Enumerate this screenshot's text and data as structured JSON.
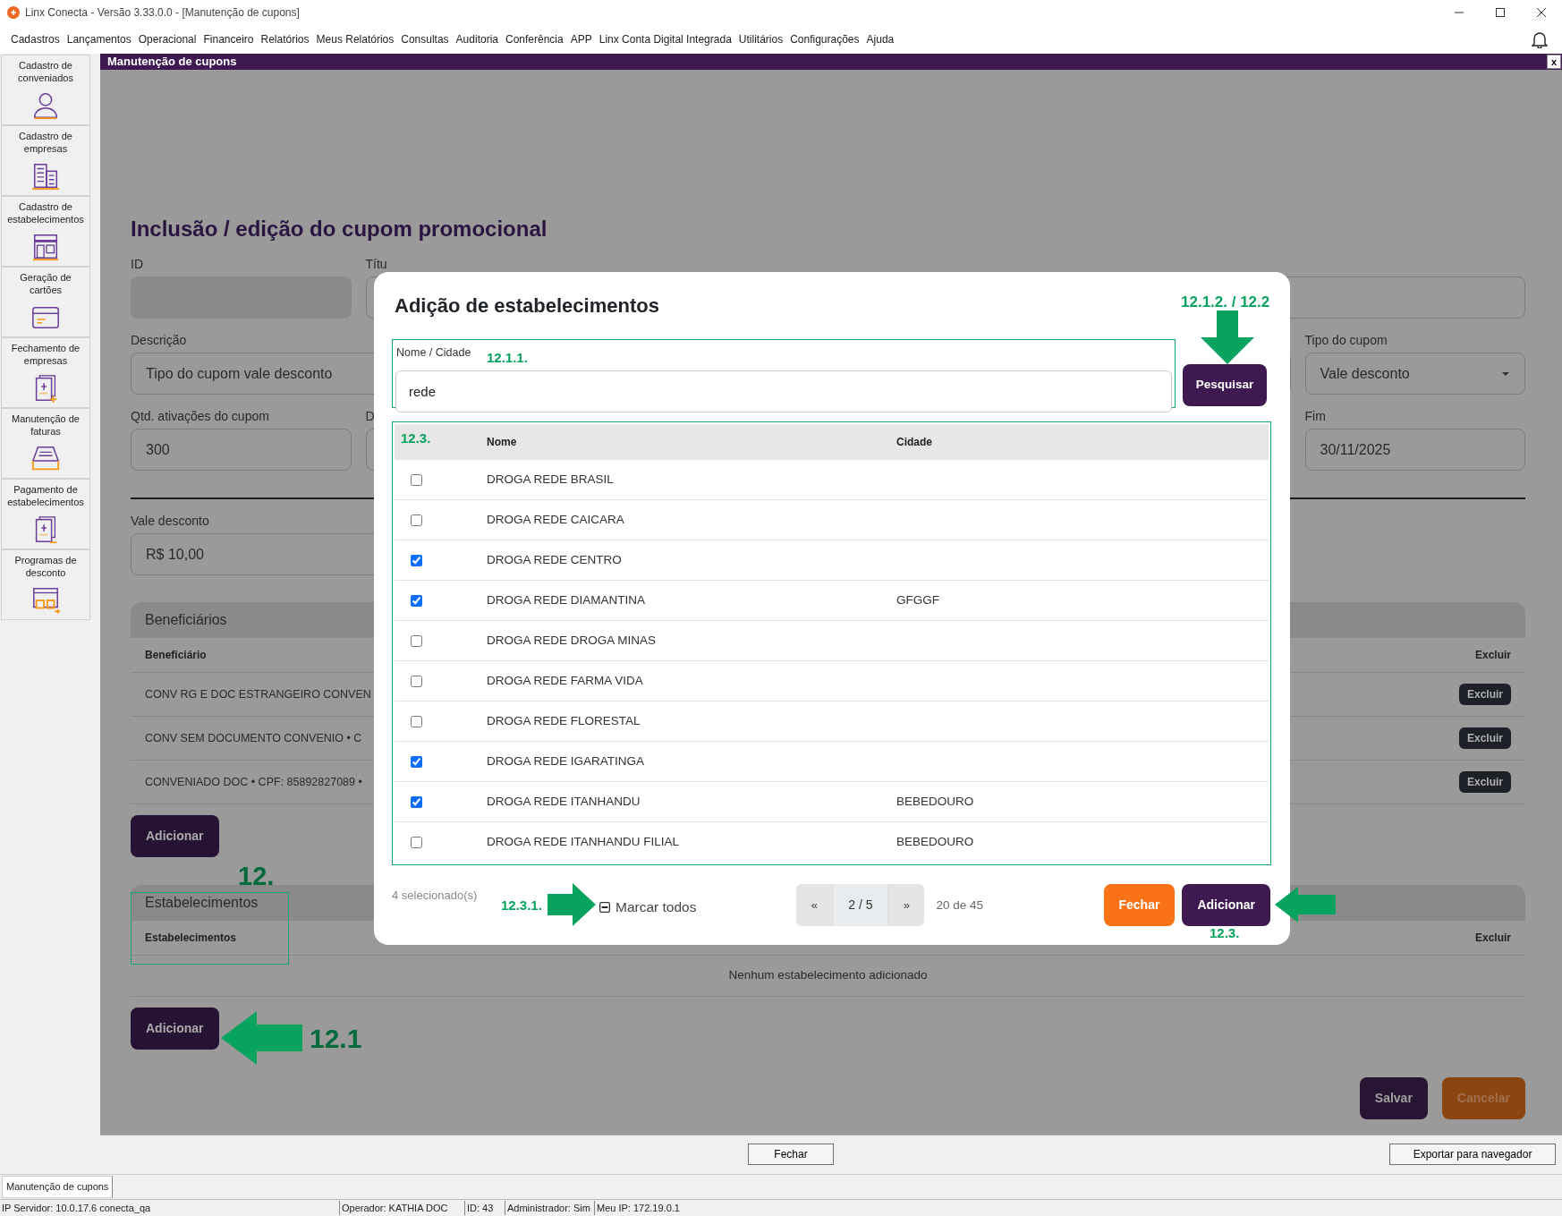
{
  "window": {
    "title": "Linx Conecta - Versão 3.33.0.0 - [Manutenção de cupons]"
  },
  "menu": [
    "Cadastros",
    "Lançamentos",
    "Operacional",
    "Financeiro",
    "Relatórios",
    "Meus Relatórios",
    "Consultas",
    "Auditoria",
    "Conferência",
    "APP",
    "Linx Conta Digital Integrada",
    "Utilitários",
    "Configurações",
    "Ajuda"
  ],
  "sidebar": [
    {
      "label": "Cadastro de conveniados"
    },
    {
      "label": "Cadastro de empresas"
    },
    {
      "label": "Cadastro de estabelecimentos"
    },
    {
      "label": "Geração de cartões"
    },
    {
      "label": "Fechamento de empresas"
    },
    {
      "label": "Manutenção de faturas"
    },
    {
      "label": "Pagamento de estabelecimentos"
    },
    {
      "label": "Programas de desconto"
    }
  ],
  "document": {
    "title": "Manutenção de cupons",
    "close": "x"
  },
  "form": {
    "heading": "Inclusão / edição do cupom promocional",
    "fields": [
      {
        "label": "ID",
        "kind": "readonly"
      },
      {
        "label": "Títu",
        "kind": "text"
      },
      {
        "label": "Descrição",
        "kind": "text",
        "value": "Tipo do cupom vale desconto"
      },
      {
        "label": "Tipo do cupom",
        "kind": "select",
        "value": "Vale desconto"
      },
      {
        "label": "Qtd. ativações do cupom",
        "kind": "text",
        "value": "300"
      },
      {
        "label": "D",
        "kind": "text"
      },
      {
        "label": "Fim",
        "kind": "text",
        "value": "30/11/2025"
      },
      {
        "label": "Vale desconto",
        "kind": "text",
        "value": "R$ 10,00"
      }
    ]
  },
  "beneficiaries": {
    "title": "Beneficiários",
    "columns": [
      "Beneficiário",
      "Excluir"
    ],
    "rows": [
      {
        "name": "CONV RG E DOC ESTRANGEIRO CONVEN",
        "action": "Excluir"
      },
      {
        "name": "CONV SEM DOCUMENTO CONVENIO • C",
        "action": "Excluir"
      },
      {
        "name": "CONVENIADO DOC • CPF: 85892827089 •",
        "action": "Excluir"
      }
    ],
    "add_button": "Adicionar"
  },
  "establishments": {
    "title": "Estabelecimentos",
    "columns": [
      "Estabelecimentos",
      "Excluir"
    ],
    "empty_message": "Nenhum estabelecimento adicionado",
    "add_button": "Adicionar"
  },
  "form_actions": [
    {
      "label": "Salvar",
      "kind": "primary"
    },
    {
      "label": "Cancelar",
      "kind": "warning"
    }
  ],
  "modal": {
    "title": "Adição de estabelecimentos",
    "search": {
      "label": "Nome / Cidade",
      "value": "rede"
    },
    "search_button": "Pesquisar",
    "table": {
      "columns": [
        "Nome",
        "Cidade"
      ],
      "rows": [
        {
          "name": "DROGA REDE BRASIL",
          "checked": false
        },
        {
          "name": "DROGA REDE CAICARA",
          "checked": false
        },
        {
          "name": "DROGA REDE CENTRO",
          "checked": true
        },
        {
          "name": "DROGA REDE DIAMANTINA",
          "city": "GFGGF",
          "checked": true
        },
        {
          "name": "DROGA REDE DROGA MINAS",
          "checked": false
        },
        {
          "name": "DROGA REDE FARMA VIDA",
          "checked": false
        },
        {
          "name": "DROGA REDE FLORESTAL",
          "checked": false
        },
        {
          "name": "DROGA REDE IGARATINGA",
          "checked": true
        },
        {
          "name": "DROGA REDE ITANHANDU",
          "city": "BEBEDOURO",
          "checked": true
        },
        {
          "name": "DROGA REDE ITANHANDU FILIAL",
          "city": "BEBEDOURO",
          "checked": false
        }
      ]
    },
    "selected_count": "4 selecionado(s)",
    "select_all": {
      "label": "Marcar todos",
      "indeterminate": true
    },
    "pagination": {
      "prev": "«",
      "page": "2 / 5",
      "next": "»"
    },
    "range": "20 de 45",
    "buttons": [
      {
        "label": "Fechar",
        "kind": "warning"
      },
      {
        "label": "Adicionar",
        "kind": "primary"
      }
    ]
  },
  "annotations": [
    {
      "text": "12.1.2. / 12.2"
    },
    {
      "text": "12.1.1."
    },
    {
      "text": "12.3."
    },
    {
      "text": "12."
    },
    {
      "text": "12.3.1."
    },
    {
      "text": "12.3."
    },
    {
      "text": "12.1"
    }
  ],
  "bottom_bar": {
    "buttons": [
      "Fechar",
      "Exportar para navegador"
    ]
  },
  "taskbar": {
    "tabs": [
      "Manutenção de cupons"
    ]
  },
  "status_bar": [
    "IP Servidor: 10.0.17.6 conecta_qa",
    "Operador: KATHIA DOC",
    "ID: 43",
    "Administrador: Sim",
    "Meu IP: 172.19.0.1"
  ]
}
